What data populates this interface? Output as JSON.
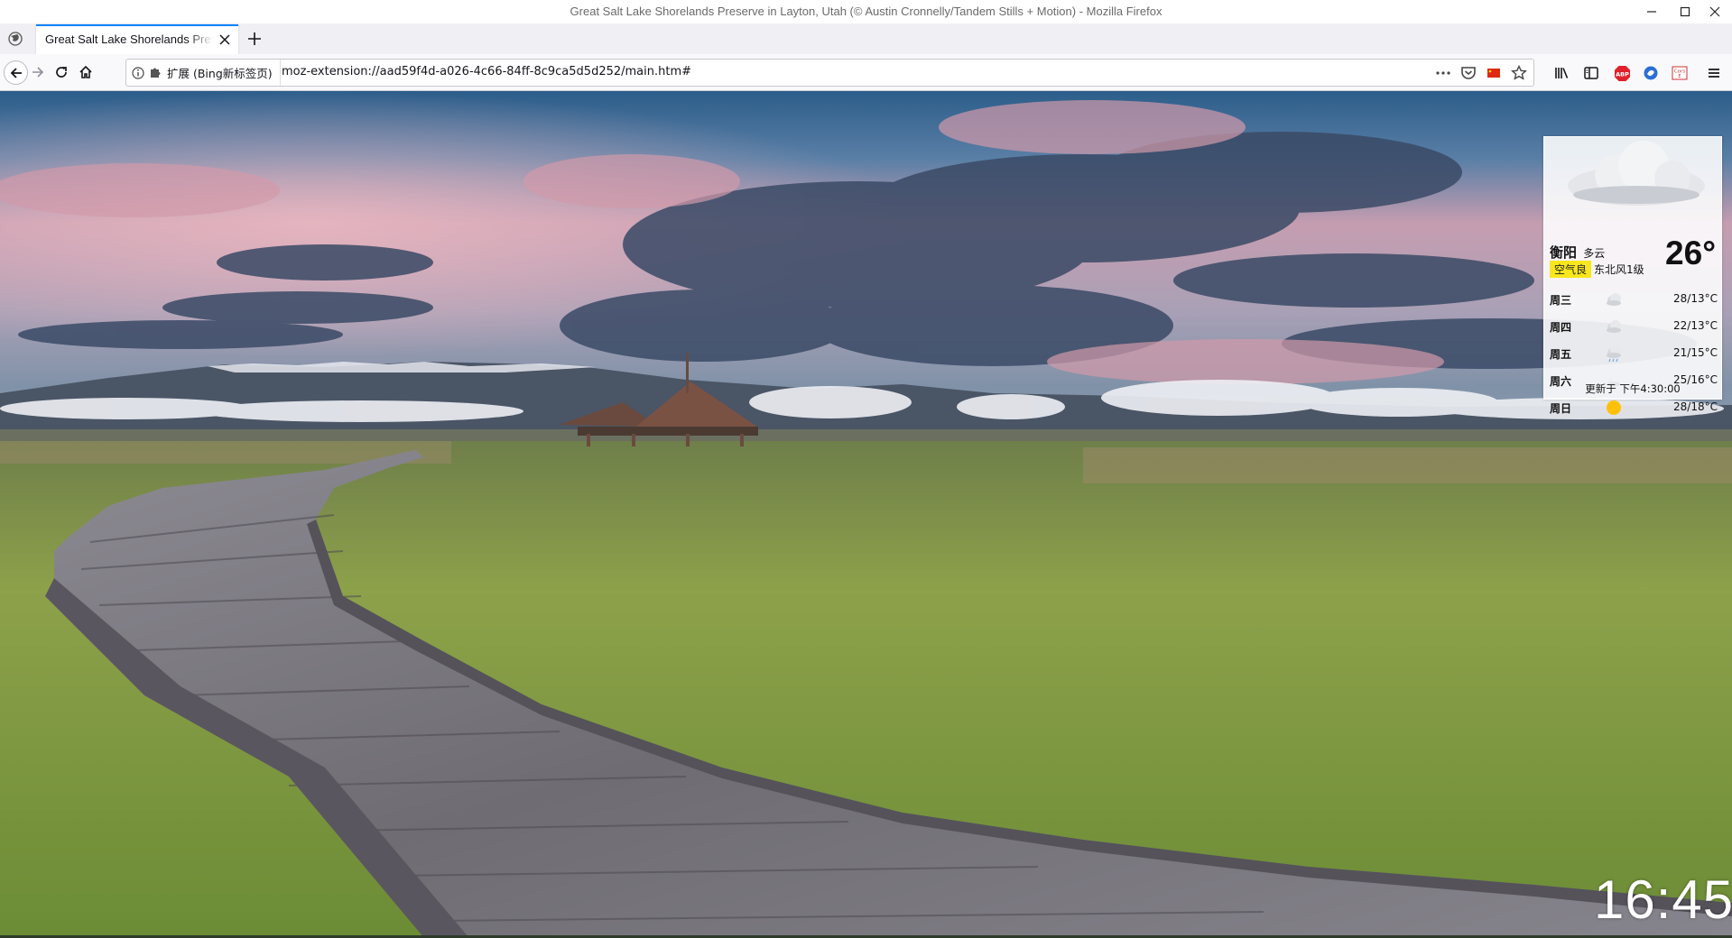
{
  "window": {
    "title": "Great Salt Lake Shorelands Preserve in Layton, Utah (© Austin Cronnelly/Tandem Stills + Motion) - Mozilla Firefox"
  },
  "tabs": [
    {
      "label": "Great Salt Lake Shorelands Preserve in Layton, Utah (© Austin Cronnelly/Tandem Stills + Motion)",
      "active": true
    }
  ],
  "urlbar": {
    "identity_label": "扩展 (Bing新标签页)",
    "url": "moz-extension://aad59f4d-a026-4c66-84ff-8c9ca5d5d252/main.htm#"
  },
  "toolbar_icons": [
    "library-icon",
    "sidebar-icon",
    "adblock-plus-icon",
    "extension-icon",
    "cors-extension-icon",
    "menu-icon"
  ],
  "weather": {
    "city": "衡阳",
    "condition": "多云",
    "temperature": "26°",
    "air_quality": "空气良",
    "wind": "东北风1级",
    "forecast": [
      {
        "day": "周三",
        "icon": "cloudy-icon",
        "range": "28/13°C"
      },
      {
        "day": "周四",
        "icon": "cloudy-icon",
        "range": "22/13°C"
      },
      {
        "day": "周五",
        "icon": "rain-icon",
        "range": "21/15°C"
      },
      {
        "day": "周六",
        "icon": "overcast-icon",
        "range": "25/16°C"
      },
      {
        "day": "周日",
        "icon": "sunny-icon",
        "range": "28/18°C"
      }
    ],
    "updated": "更新于 下午4:30:00"
  },
  "clock": "16:45",
  "colors": {
    "accent": "#0a84ff",
    "aqi_badge": "#f8e71c",
    "adblock": "#e0212a"
  }
}
